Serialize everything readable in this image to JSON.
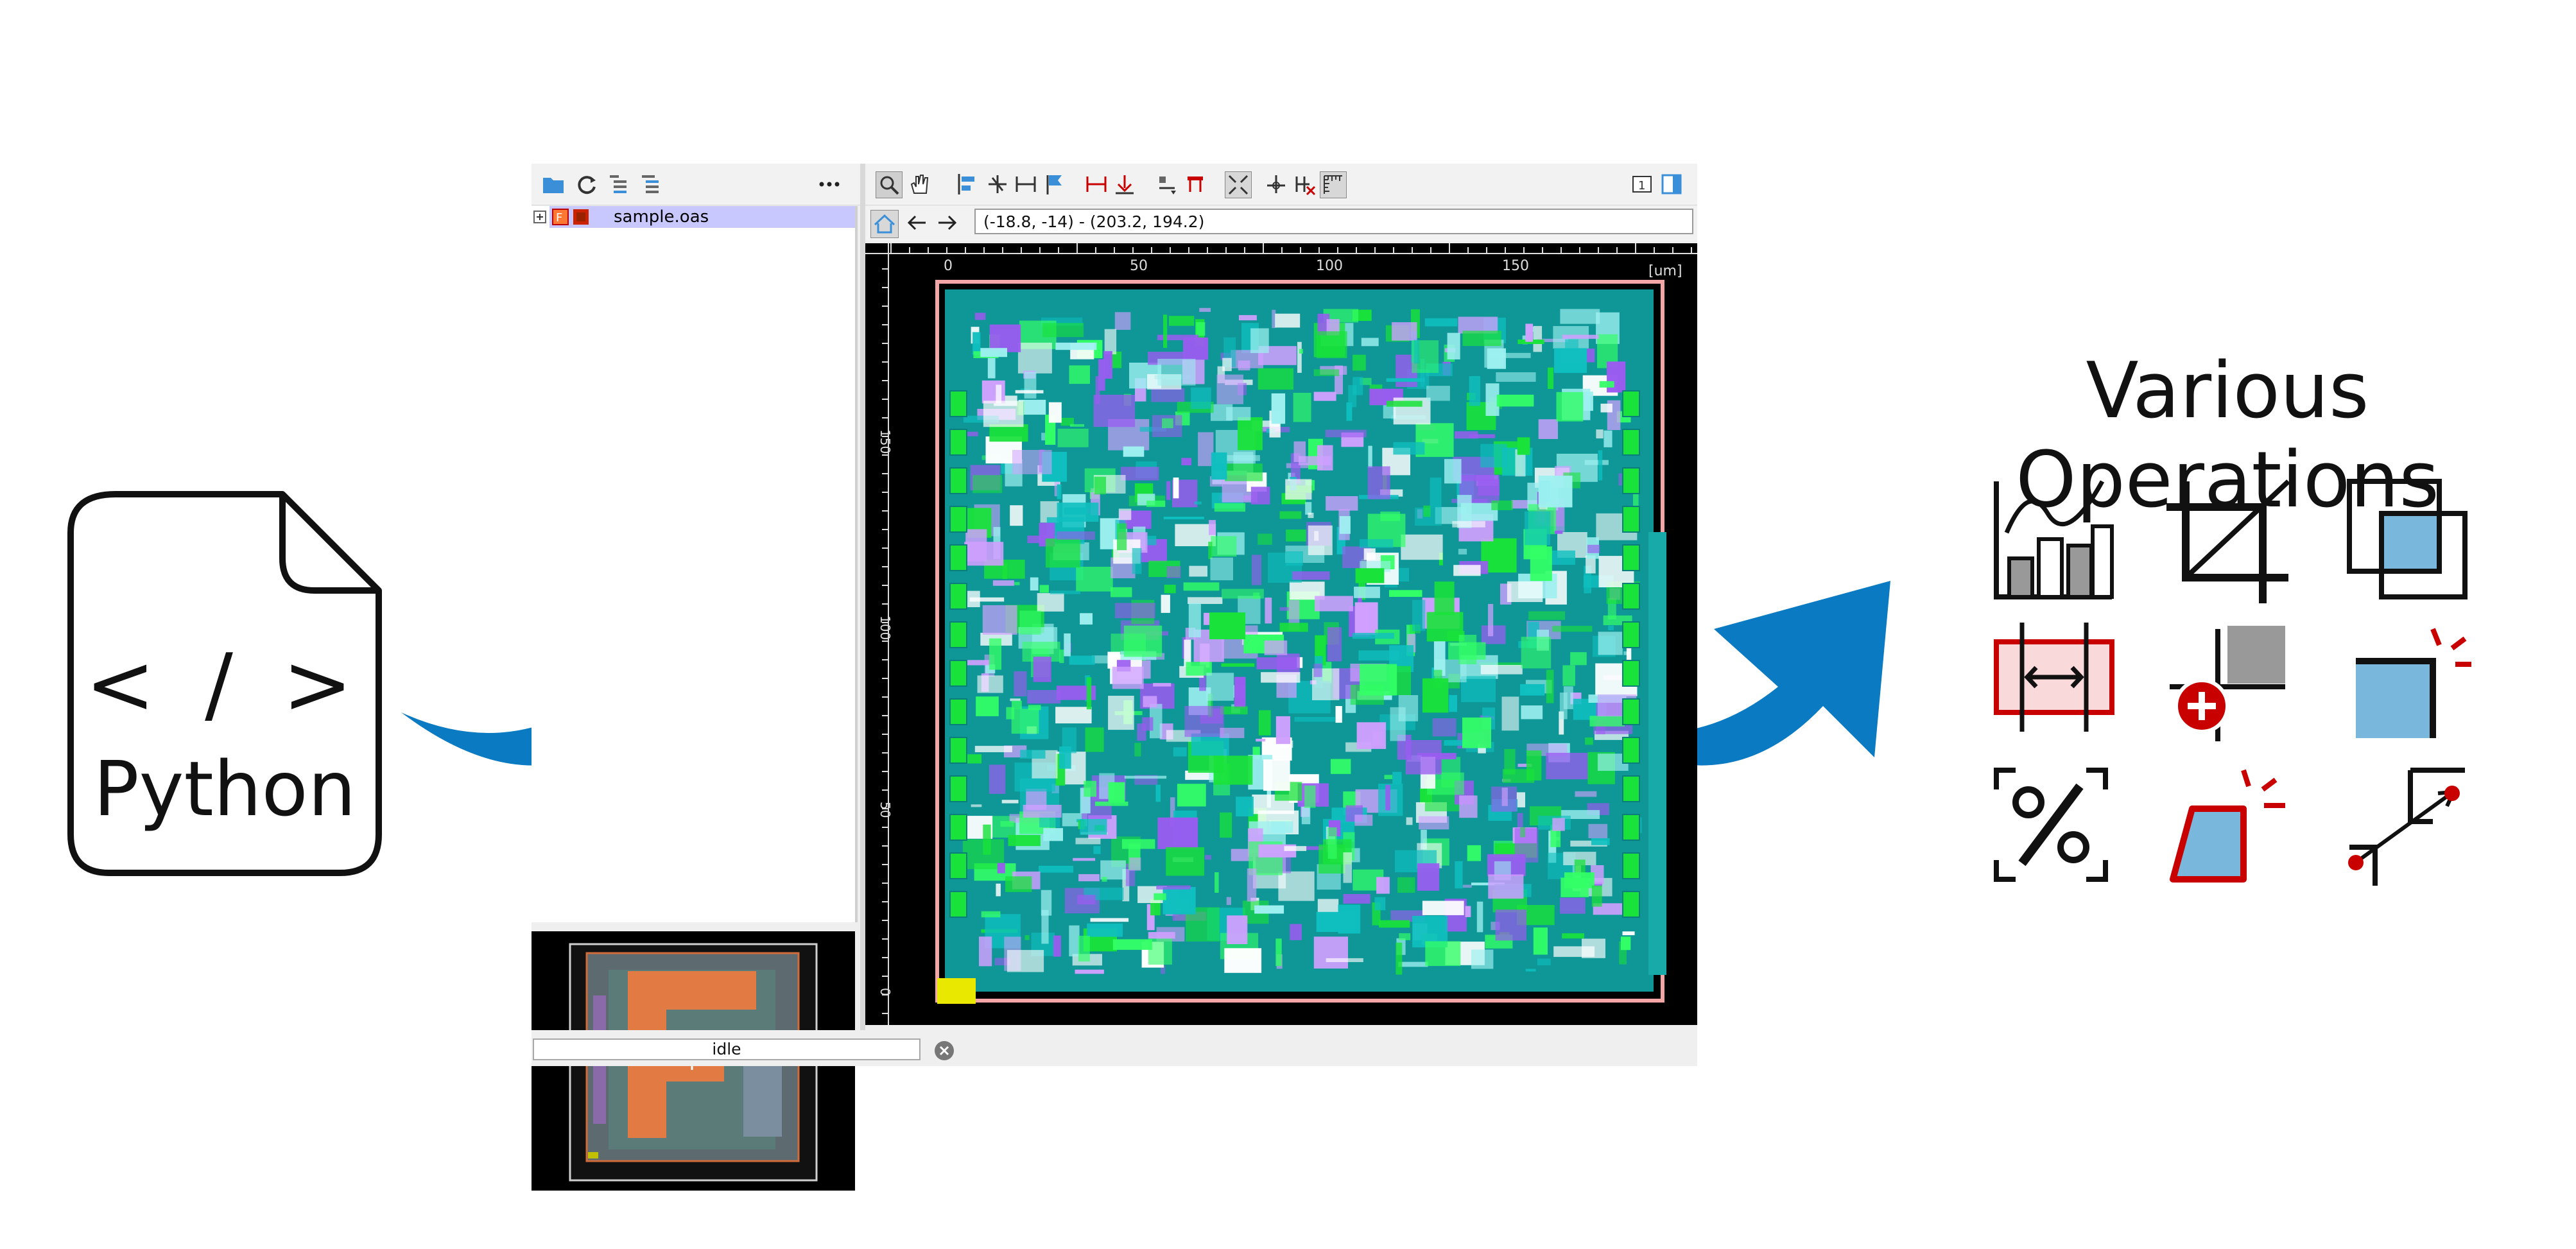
{
  "python_file": {
    "code_symbol": "< / >",
    "label": "Python"
  },
  "app": {
    "cell_tree": {
      "file_name": "sample.oas"
    },
    "navigation": {
      "coordinates": "(-18.8, -14) - (203.2, 194.2)"
    },
    "ruler": {
      "x_ticks": [
        "0",
        "50",
        "100",
        "150"
      ],
      "y_ticks": [
        "150",
        "100",
        "50",
        "0"
      ],
      "unit": "[um]"
    },
    "status": {
      "progress_text": "idle"
    }
  },
  "operations": {
    "title": "Various Operations",
    "icons": [
      "chart-icon",
      "crop-icon",
      "overlap-boolean-icon",
      "width-measure-icon",
      "add-corner-icon",
      "corner-highlight-icon",
      "density-percent-icon",
      "trapezoid-highlight-icon",
      "distance-measure-icon"
    ]
  },
  "colors": {
    "arrow": "#0a7ac2",
    "accent_red": "#c80000",
    "fill_blue": "#79b8dc"
  }
}
